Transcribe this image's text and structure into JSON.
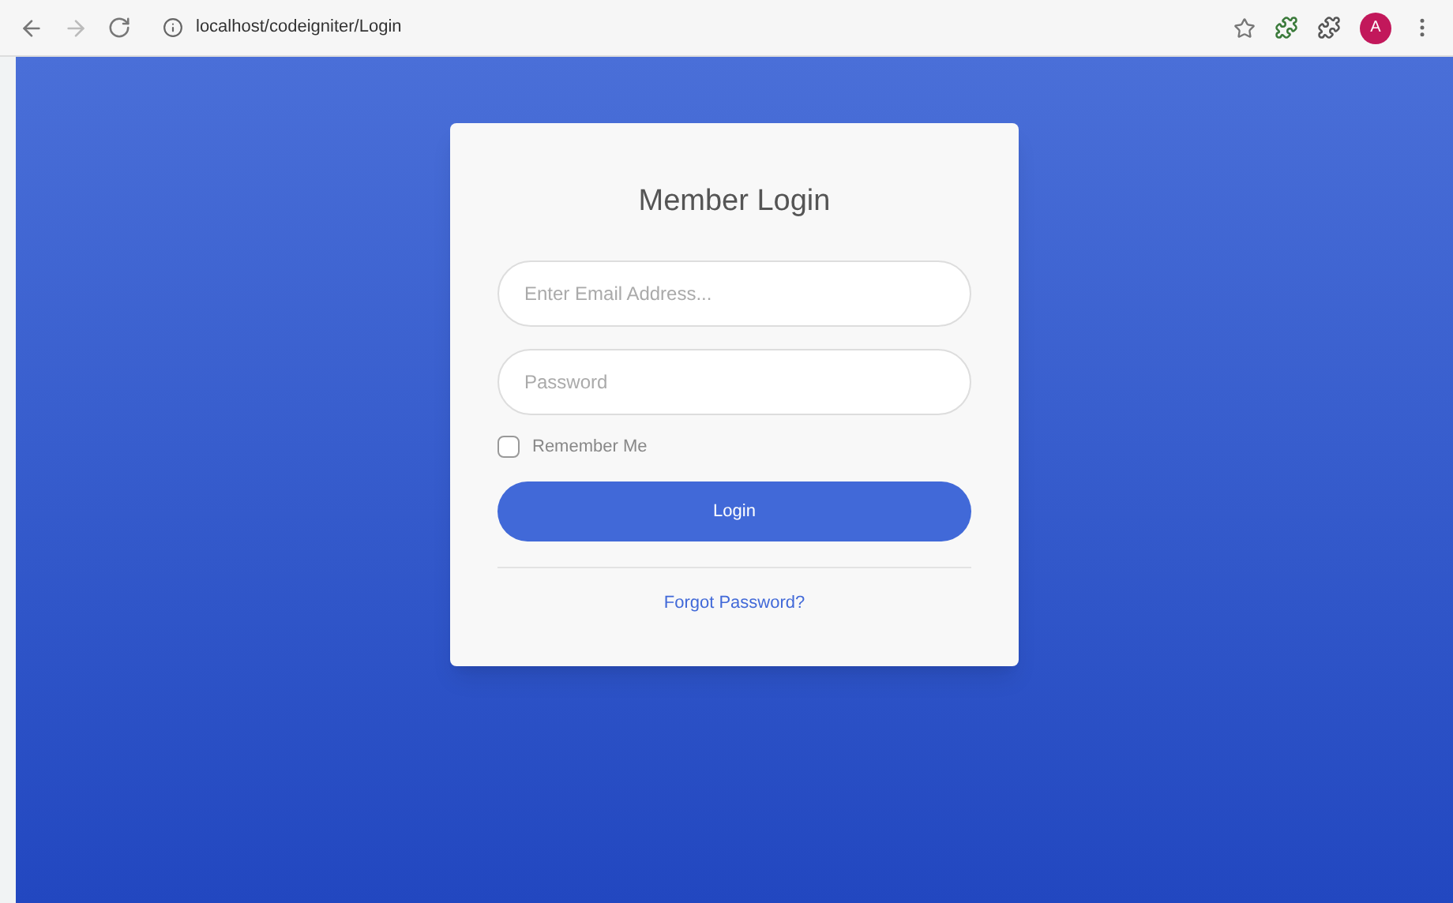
{
  "browser": {
    "url": "localhost/codeigniter/Login",
    "avatar": "A"
  },
  "login": {
    "title": "Member Login",
    "email": {
      "placeholder": "Enter Email Address..."
    },
    "password": {
      "placeholder": "Password"
    },
    "remember": {
      "label": "Remember Me",
      "checked": false
    },
    "button": "Login",
    "forgot": "Forgot Password?"
  }
}
